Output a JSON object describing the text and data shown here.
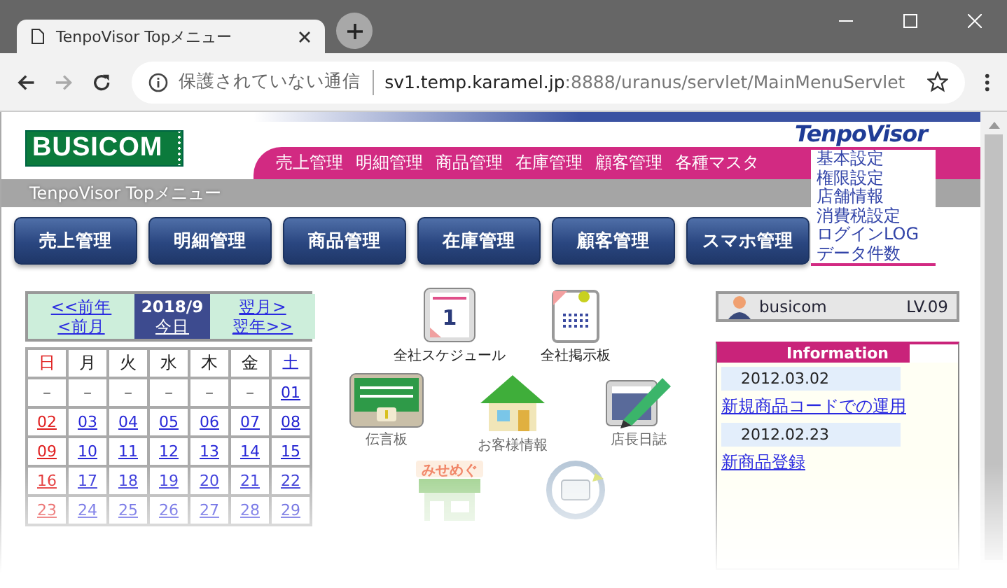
{
  "browser": {
    "tab_title": "TenpoVisor Topメニュー",
    "security": "保護されていない通信",
    "url_host": "sv1.temp.karamel.jp",
    "url_path": ":8888/uranus/servlet/MainMenuServlet"
  },
  "header": {
    "logo": "BUSICOM",
    "brand": "TenpoVisor",
    "menu": [
      "売上管理",
      "明細管理",
      "商品管理",
      "在庫管理",
      "顧客管理",
      "各種マスタ"
    ],
    "dropdown": [
      "基本設定",
      "権限設定",
      "店舗情報",
      "消費税設定",
      "ログインLOG",
      "データ件数"
    ]
  },
  "title_bar": "TenpoVisor Topメニュー",
  "buttons": [
    "売上管理",
    "明細管理",
    "商品管理",
    "在庫管理",
    "顧客管理",
    "スマホ管理"
  ],
  "calendar": {
    "prev_year": "<<前年",
    "prev_month": "<前月",
    "current": "2018/9",
    "today": "今日",
    "next_month": "翌月>",
    "next_year": "翌年>>",
    "weekdays": [
      "日",
      "月",
      "火",
      "水",
      "木",
      "金",
      "土"
    ],
    "weeks": [
      [
        "－",
        "－",
        "－",
        "－",
        "－",
        "－",
        "01"
      ],
      [
        "02",
        "03",
        "04",
        "05",
        "06",
        "07",
        "08"
      ],
      [
        "09",
        "10",
        "11",
        "12",
        "13",
        "14",
        "15"
      ],
      [
        "16",
        "17",
        "18",
        "19",
        "20",
        "21",
        "22"
      ],
      [
        "23",
        "24",
        "25",
        "26",
        "27",
        "28",
        "29"
      ]
    ]
  },
  "icons": [
    {
      "kind": "schedule",
      "day": "1",
      "label": "全社スケジュール"
    },
    {
      "kind": "board",
      "label": "全社掲示板"
    },
    {
      "kind": "message",
      "label": "伝言板"
    },
    {
      "kind": "customer",
      "label": "お客様情報"
    },
    {
      "kind": "diary",
      "label": "店長日誌"
    },
    {
      "kind": "shop",
      "sign": "みせめぐ"
    },
    {
      "kind": "sync"
    }
  ],
  "user": {
    "name": "busicom",
    "level": "LV.09"
  },
  "information": {
    "title": "Information",
    "entries": [
      {
        "date": "2012.03.02",
        "link": "新規商品コードでの運用"
      },
      {
        "date": "2012.02.23",
        "link": "新商品登録"
      }
    ]
  }
}
